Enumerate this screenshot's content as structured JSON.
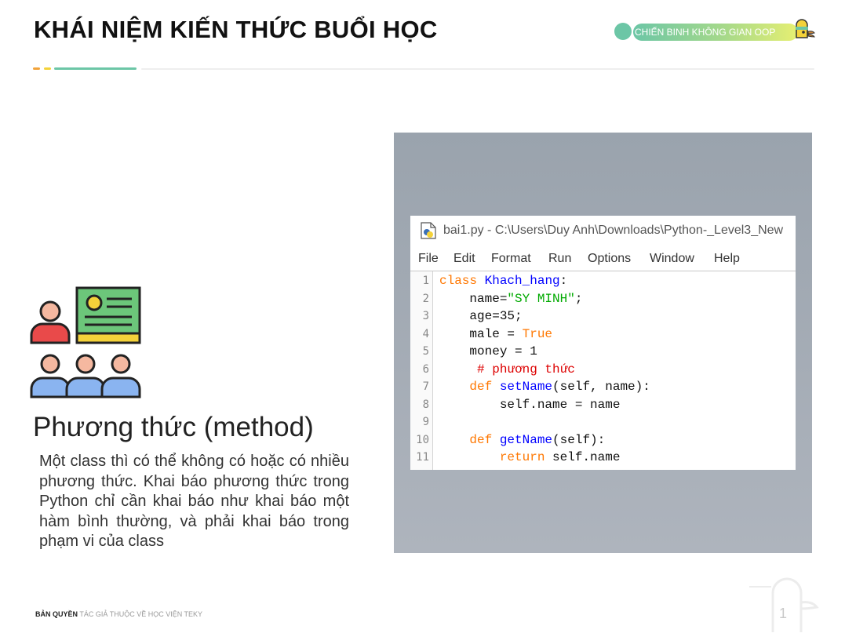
{
  "header": {
    "title": "KHÁI NIỆM KIẾN THỨC BUỔI HỌC",
    "badge": "CHIẾN BINH KHÔNG GIAN OOP"
  },
  "content": {
    "heading": "Phương thức (method)",
    "paragraph": "Một class thì có thể không có hoặc có nhiều phương thức. Khai báo phương thức trong Python chỉ cần khai báo như khai báo một hàm bình thường, và phải khai báo trong phạm vi của class"
  },
  "idle_window": {
    "title": "bai1.py - C:\\Users\\Duy Anh\\Downloads\\Python-_Level3_New",
    "menu": [
      "File",
      "Edit",
      "Format",
      "Run",
      "Options",
      "Window",
      "Help"
    ],
    "line_numbers": [
      "1",
      "2",
      "3",
      "4",
      "5",
      "6",
      "7",
      "8",
      "9",
      "10",
      "11"
    ],
    "code": {
      "l1_kw": "class",
      "l1_fn": "Khach_hang",
      "l1_rest": ":",
      "l2_a": "    name=",
      "l2_str": "\"SY MINH\"",
      "l2_b": ";",
      "l3": "    age=35;",
      "l4_a": "    male = ",
      "l4_kw": "True",
      "l5": "    money = 1",
      "l6_comment": "     # phương thức",
      "l7_kw": "    def",
      "l7_fn": " setName",
      "l7_rest": "(self, name):",
      "l8": "        self.name = name",
      "l10_kw": "    def",
      "l10_fn": " getName",
      "l10_rest": "(self):",
      "l11_kw": "        return",
      "l11_rest": " self.name"
    }
  },
  "footer": {
    "bold": "BẢN QUYỀN",
    "rest": " TÁC GIẢ THUỘC VỀ HỌC VIỆN TEKY"
  },
  "page_number": "1",
  "colors": {
    "accent_green": "#6cc6a6",
    "accent_orange": "#f2a33a",
    "accent_yellow": "#f4d23a",
    "keyword": "#ff7700",
    "function": "#0000ff",
    "string": "#00aa00",
    "comment": "#dd0000"
  }
}
